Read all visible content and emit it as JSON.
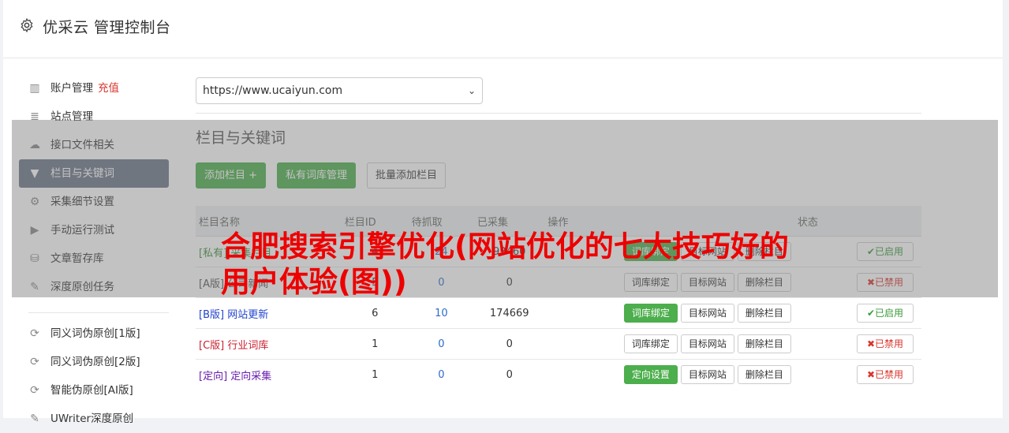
{
  "app": {
    "title": "优采云 管理控制台"
  },
  "sidebar": {
    "items": [
      {
        "icon": "bar-chart-icon",
        "glyph": "▥",
        "label": "账户管理",
        "extra": "充值"
      },
      {
        "icon": "server-icon",
        "glyph": "≣",
        "label": "站点管理"
      },
      {
        "icon": "cloud-upload-icon",
        "glyph": "☁",
        "label": "接口文件相关"
      },
      {
        "icon": "filter-icon",
        "glyph": "▼",
        "label": "栏目与关键词",
        "active": true
      },
      {
        "icon": "cogs-icon",
        "glyph": "⚙",
        "label": "采集细节设置"
      },
      {
        "icon": "play-icon",
        "glyph": "▶",
        "label": "手动运行测试"
      },
      {
        "icon": "database-icon",
        "glyph": "⛁",
        "label": "文章暂存库"
      },
      {
        "icon": "edit-icon",
        "glyph": "✎",
        "label": "深度原创任务"
      }
    ],
    "items2": [
      {
        "icon": "refresh-icon",
        "glyph": "⟳",
        "label": "同义词伪原创[1版]"
      },
      {
        "icon": "refresh-icon",
        "glyph": "⟳",
        "label": "同义词伪原创[2版]"
      },
      {
        "icon": "refresh-icon",
        "glyph": "⟳",
        "label": "智能伪原创[AI版]"
      },
      {
        "icon": "edit-icon",
        "glyph": "✎",
        "label": "UWriter深度原创"
      }
    ]
  },
  "main": {
    "site_select": "https://www.ucaiyun.com",
    "section_title": "栏目与关键词",
    "buttons": {
      "add": "添加栏目 +",
      "private": "私有词库管理",
      "batch": "批量添加栏目"
    },
    "table": {
      "headers": {
        "name": "栏目名称",
        "id": "栏目ID",
        "pending": "待抓取",
        "collected": "已采集",
        "ops": "操作",
        "status": "状态"
      },
      "rows": [
        {
          "tag": "[私有]",
          "name": "采集栏目",
          "id": "4",
          "pending": "24",
          "collected": "92460",
          "op1": "词库绑定",
          "op1_green": true,
          "op2": "目标网站",
          "op3": "删除栏目",
          "status": "✔已启用",
          "on": true,
          "tagclass": "tag-private"
        },
        {
          "tag": "[A版]",
          "name": "公司新闻",
          "id": "5",
          "pending": "0",
          "collected": "0",
          "op1": "词库绑定",
          "op1_green": false,
          "op2": "目标网站",
          "op3": "删除栏目",
          "status": "✖已禁用",
          "on": false,
          "tagclass": "tag-a"
        },
        {
          "tag": "[B版]",
          "name": "网站更新",
          "id": "6",
          "pending": "10",
          "collected": "174669",
          "op1": "词库绑定",
          "op1_green": true,
          "op2": "目标网站",
          "op3": "删除栏目",
          "status": "✔已启用",
          "on": true,
          "tagclass": "tag-b"
        },
        {
          "tag": "[C版]",
          "name": "行业词库",
          "id": "1",
          "pending": "0",
          "collected": "0",
          "op1": "词库绑定",
          "op1_green": false,
          "op2": "目标网站",
          "op3": "删除栏目",
          "status": "✖已禁用",
          "on": false,
          "tagclass": "tag-c"
        },
        {
          "tag": "[定向]",
          "name": "定向采集",
          "id": "1",
          "pending": "0",
          "collected": "0",
          "op1": "定向设置",
          "op1_green": true,
          "op2": "目标网站",
          "op3": "删除栏目",
          "status": "✖已禁用",
          "on": false,
          "tagclass": "tag-d"
        }
      ]
    }
  },
  "overlay": {
    "headline": "合肥搜索引擎优化(网站优化的七大技巧好的用户体验(图))"
  },
  "colors": {
    "accent_green": "#4cae4c",
    "active_nav": "#6b7587",
    "headline_red": "#ee0000"
  }
}
